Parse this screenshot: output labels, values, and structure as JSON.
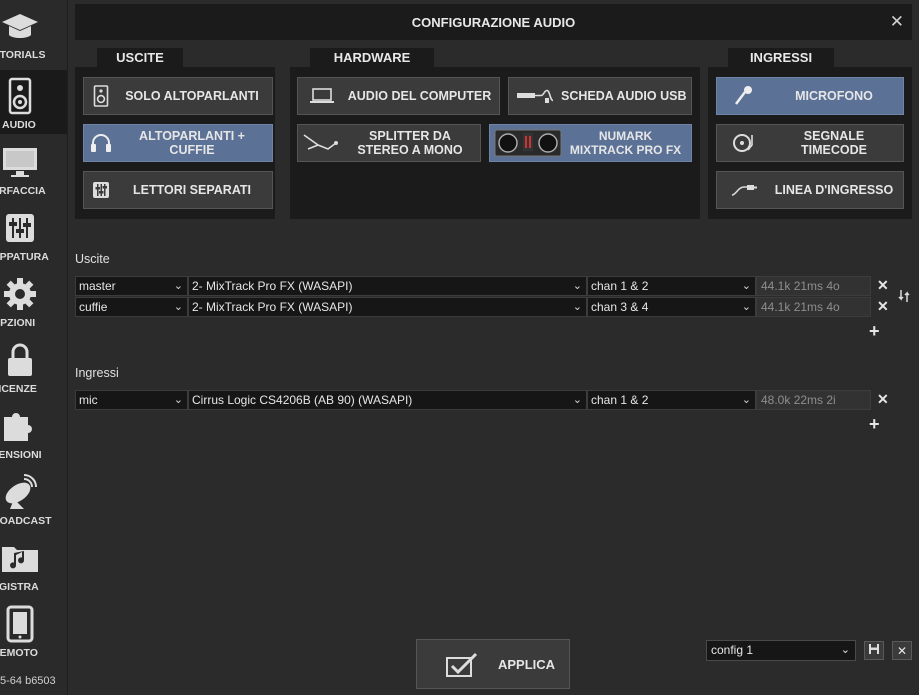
{
  "sidebar": {
    "items": [
      {
        "label": "UTORIALS",
        "icon": "graduation-cap-icon"
      },
      {
        "label": "AUDIO",
        "icon": "speaker-icon"
      },
      {
        "label": "ERFACCIA",
        "icon": "monitor-icon"
      },
      {
        "label": "APPATURA",
        "icon": "sliders-icon"
      },
      {
        "label": "OPZIONI",
        "icon": "gear-icon"
      },
      {
        "label": "LICENZE",
        "icon": "lock-icon"
      },
      {
        "label": "TENSIONI",
        "icon": "puzzle-icon"
      },
      {
        "label": "ROADCAST",
        "icon": "satellite-dish-icon"
      },
      {
        "label": "EGISTRA",
        "icon": "music-folder-icon"
      },
      {
        "label": "REMOTO",
        "icon": "tablet-icon"
      }
    ],
    "version": "5-64 b6503"
  },
  "dialog": {
    "title": "CONFIGURAZIONE AUDIO",
    "close": "✕"
  },
  "groups": {
    "uscite": {
      "title": "USCITE",
      "buttons": [
        "SOLO ALTOPARLANTI",
        "ALTOPARLANTI + CUFFIE",
        "LETTORI SEPARATI"
      ]
    },
    "hardware": {
      "title": "HARDWARE",
      "buttons": [
        "AUDIO DEL COMPUTER",
        "SCHEDA AUDIO USB",
        "SPLITTER DA STEREO A MONO",
        "NUMARK MIXTRACK PRO FX"
      ]
    },
    "ingressi": {
      "title": "INGRESSI",
      "buttons": [
        "MICROFONO",
        "SEGNALE TIMECODE",
        "LINEA D'INGRESSO"
      ]
    }
  },
  "outputs": {
    "label": "Uscite",
    "rows": [
      {
        "name": "master",
        "device": "2- MixTrack Pro FX (WASAPI)",
        "channels": "chan 1 & 2",
        "info": "44.1k 21ms 4o"
      },
      {
        "name": "cuffie",
        "device": "2- MixTrack Pro FX (WASAPI)",
        "channels": "chan 3 & 4",
        "info": "44.1k 21ms 4o"
      }
    ]
  },
  "inputs": {
    "label": "Ingressi",
    "rows": [
      {
        "name": "mic",
        "device": "Cirrus Logic CS4206B (AB 90) (WASAPI)",
        "channels": "chan 1 & 2",
        "info": "48.0k 22ms 2i"
      }
    ]
  },
  "footer": {
    "apply": "APPLICA",
    "config": "config 1"
  },
  "colors": {
    "selected": "#5b7196",
    "panel": "#1b1b1b",
    "background": "#2b2b2b"
  }
}
